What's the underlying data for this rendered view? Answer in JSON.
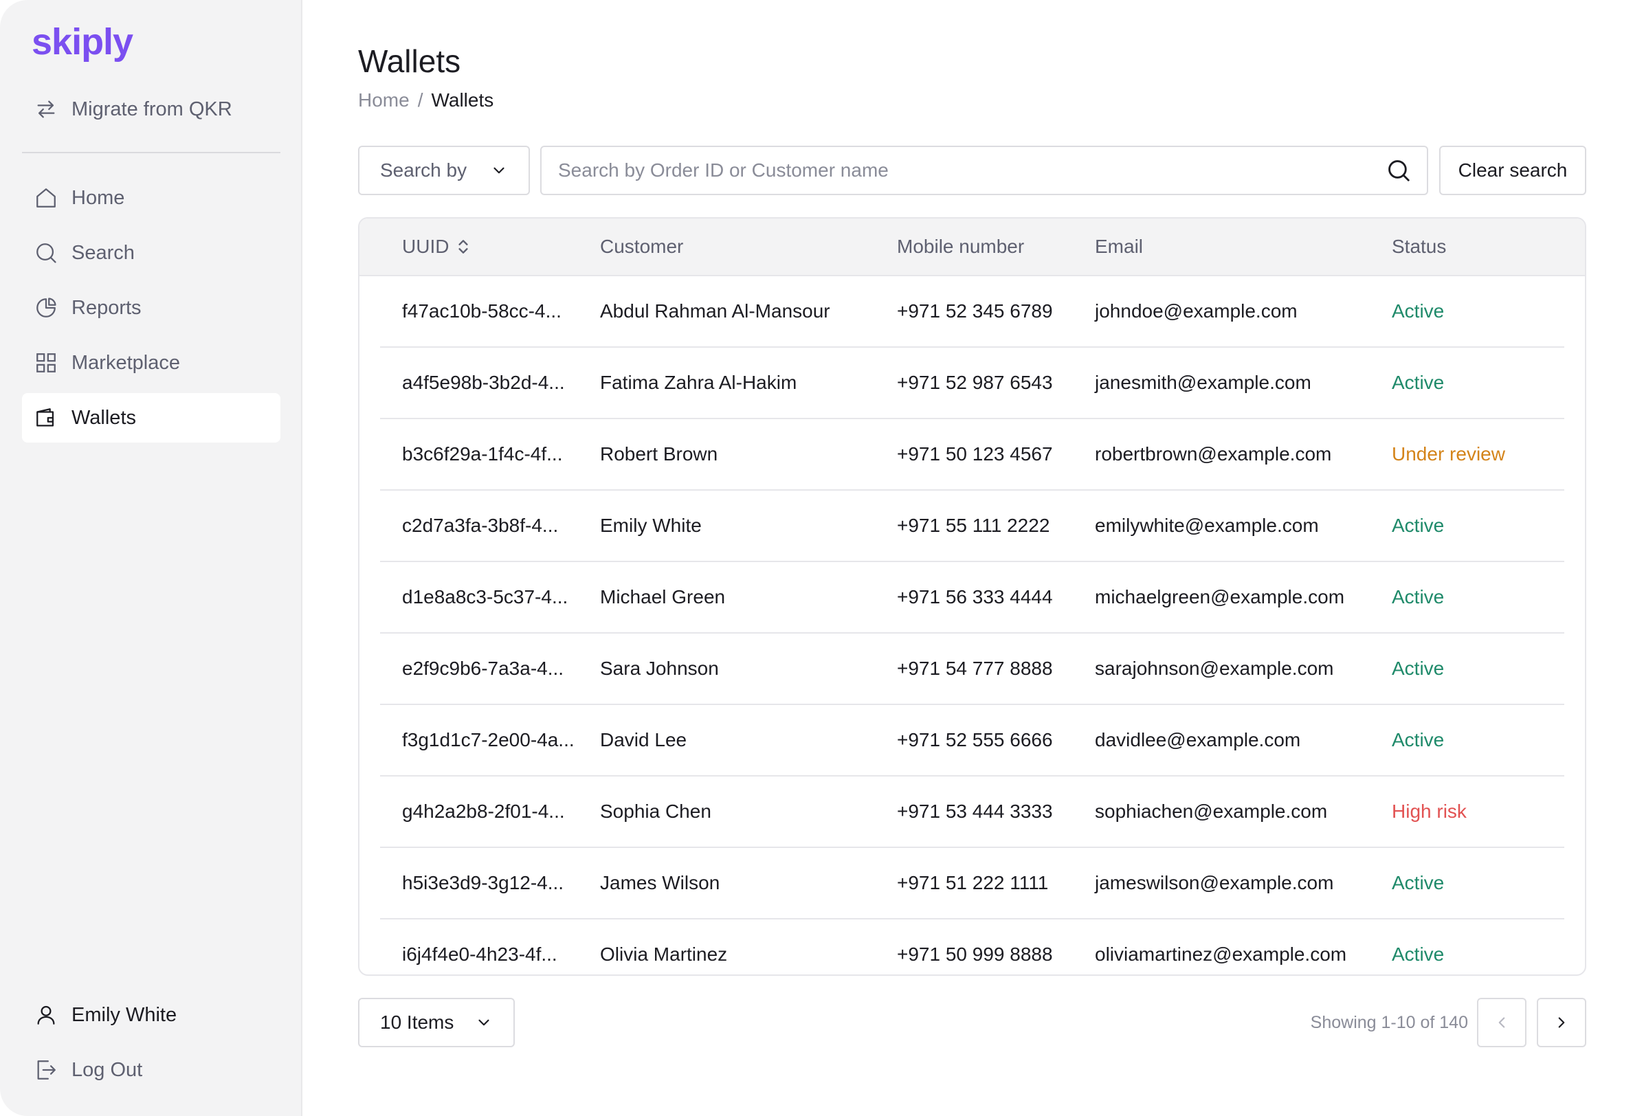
{
  "brand": {
    "name": "skiply",
    "accent": "#7b4ff0"
  },
  "sidebar": {
    "migrate": {
      "label": "Migrate from QKR",
      "icon": "swap-arrows-icon"
    },
    "items": [
      {
        "label": "Home",
        "icon": "home-icon",
        "active": false
      },
      {
        "label": "Search",
        "icon": "search-icon",
        "active": false
      },
      {
        "label": "Reports",
        "icon": "pie-chart-icon",
        "active": false
      },
      {
        "label": "Marketplace",
        "icon": "grid-icon",
        "active": false
      },
      {
        "label": "Wallets",
        "icon": "wallet-icon",
        "active": true
      }
    ],
    "user": {
      "name": "Emily White",
      "icon": "user-icon"
    },
    "logout": {
      "label": "Log Out",
      "icon": "logout-icon"
    }
  },
  "page": {
    "title": "Wallets",
    "breadcrumb": {
      "home": "Home",
      "separator": "/",
      "current": "Wallets"
    }
  },
  "toolbar": {
    "search_by": "Search by",
    "search_placeholder": "Search by Order ID or Customer name",
    "clear_label": "Clear search"
  },
  "table": {
    "columns": [
      "UUID",
      "Customer",
      "Mobile number",
      "Email",
      "Status"
    ],
    "rows": [
      {
        "uuid": "f47ac10b-58cc-4...",
        "customer": "Abdul Rahman Al-Mansour",
        "mobile": "+971 52 345 6789",
        "email": "johndoe@example.com",
        "status": "Active"
      },
      {
        "uuid": "a4f5e98b-3b2d-4...",
        "customer": "Fatima Zahra Al-Hakim",
        "mobile": "+971 52 987 6543",
        "email": "janesmith@example.com",
        "status": "Active"
      },
      {
        "uuid": "b3c6f29a-1f4c-4f...",
        "customer": "Robert Brown",
        "mobile": "+971 50 123 4567",
        "email": "robertbrown@example.com",
        "status": "Under review"
      },
      {
        "uuid": "c2d7a3fa-3b8f-4...",
        "customer": "Emily White",
        "mobile": "+971 55 111 2222",
        "email": "emilywhite@example.com",
        "status": "Active"
      },
      {
        "uuid": "d1e8a8c3-5c37-4...",
        "customer": "Michael Green",
        "mobile": "+971 56 333 4444",
        "email": "michaelgreen@example.com",
        "status": "Active"
      },
      {
        "uuid": "e2f9c9b6-7a3a-4...",
        "customer": "Sara Johnson",
        "mobile": "+971 54 777 8888",
        "email": "sarajohnson@example.com",
        "status": "Active"
      },
      {
        "uuid": "f3g1d1c7-2e00-4a...",
        "customer": "David Lee",
        "mobile": "+971 52 555 6666",
        "email": "davidlee@example.com",
        "status": "Active"
      },
      {
        "uuid": "g4h2a2b8-2f01-4...",
        "customer": "Sophia Chen",
        "mobile": "+971 53 444 3333",
        "email": "sophiachen@example.com",
        "status": "High risk"
      },
      {
        "uuid": "h5i3e3d9-3g12-4...",
        "customer": "James Wilson",
        "mobile": "+971 51 222 1111",
        "email": "jameswilson@example.com",
        "status": "Active"
      },
      {
        "uuid": "i6j4f4e0-4h23-4f...",
        "customer": "Olivia Martinez",
        "mobile": "+971 50 999 8888",
        "email": "oliviamartinez@example.com",
        "status": "Active"
      }
    ]
  },
  "status_colors": {
    "Active": "#1f8a6a",
    "Under review": "#d4841a",
    "High risk": "#e25252"
  },
  "pagination": {
    "items_label": "10 Items",
    "showing": "Showing 1-10 of 140"
  }
}
